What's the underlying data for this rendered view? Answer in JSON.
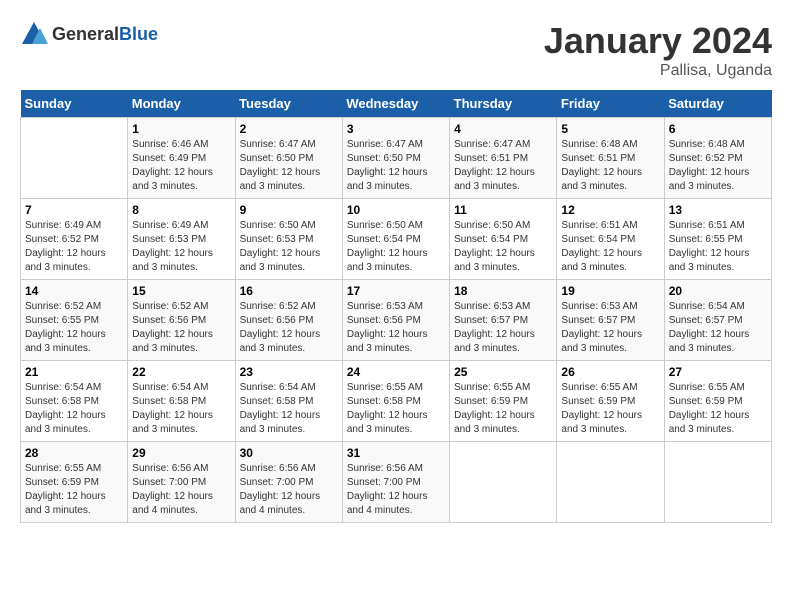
{
  "logo": {
    "general": "General",
    "blue": "Blue"
  },
  "title": "January 2024",
  "subtitle": "Pallisa, Uganda",
  "days_of_week": [
    "Sunday",
    "Monday",
    "Tuesday",
    "Wednesday",
    "Thursday",
    "Friday",
    "Saturday"
  ],
  "weeks": [
    [
      {
        "day": "",
        "sunrise": "",
        "sunset": "",
        "daylight": ""
      },
      {
        "day": "1",
        "sunrise": "Sunrise: 6:46 AM",
        "sunset": "Sunset: 6:49 PM",
        "daylight": "Daylight: 12 hours and 3 minutes."
      },
      {
        "day": "2",
        "sunrise": "Sunrise: 6:47 AM",
        "sunset": "Sunset: 6:50 PM",
        "daylight": "Daylight: 12 hours and 3 minutes."
      },
      {
        "day": "3",
        "sunrise": "Sunrise: 6:47 AM",
        "sunset": "Sunset: 6:50 PM",
        "daylight": "Daylight: 12 hours and 3 minutes."
      },
      {
        "day": "4",
        "sunrise": "Sunrise: 6:47 AM",
        "sunset": "Sunset: 6:51 PM",
        "daylight": "Daylight: 12 hours and 3 minutes."
      },
      {
        "day": "5",
        "sunrise": "Sunrise: 6:48 AM",
        "sunset": "Sunset: 6:51 PM",
        "daylight": "Daylight: 12 hours and 3 minutes."
      },
      {
        "day": "6",
        "sunrise": "Sunrise: 6:48 AM",
        "sunset": "Sunset: 6:52 PM",
        "daylight": "Daylight: 12 hours and 3 minutes."
      }
    ],
    [
      {
        "day": "7",
        "sunrise": "Sunrise: 6:49 AM",
        "sunset": "Sunset: 6:52 PM",
        "daylight": "Daylight: 12 hours and 3 minutes."
      },
      {
        "day": "8",
        "sunrise": "Sunrise: 6:49 AM",
        "sunset": "Sunset: 6:53 PM",
        "daylight": "Daylight: 12 hours and 3 minutes."
      },
      {
        "day": "9",
        "sunrise": "Sunrise: 6:50 AM",
        "sunset": "Sunset: 6:53 PM",
        "daylight": "Daylight: 12 hours and 3 minutes."
      },
      {
        "day": "10",
        "sunrise": "Sunrise: 6:50 AM",
        "sunset": "Sunset: 6:54 PM",
        "daylight": "Daylight: 12 hours and 3 minutes."
      },
      {
        "day": "11",
        "sunrise": "Sunrise: 6:50 AM",
        "sunset": "Sunset: 6:54 PM",
        "daylight": "Daylight: 12 hours and 3 minutes."
      },
      {
        "day": "12",
        "sunrise": "Sunrise: 6:51 AM",
        "sunset": "Sunset: 6:54 PM",
        "daylight": "Daylight: 12 hours and 3 minutes."
      },
      {
        "day": "13",
        "sunrise": "Sunrise: 6:51 AM",
        "sunset": "Sunset: 6:55 PM",
        "daylight": "Daylight: 12 hours and 3 minutes."
      }
    ],
    [
      {
        "day": "14",
        "sunrise": "Sunrise: 6:52 AM",
        "sunset": "Sunset: 6:55 PM",
        "daylight": "Daylight: 12 hours and 3 minutes."
      },
      {
        "day": "15",
        "sunrise": "Sunrise: 6:52 AM",
        "sunset": "Sunset: 6:56 PM",
        "daylight": "Daylight: 12 hours and 3 minutes."
      },
      {
        "day": "16",
        "sunrise": "Sunrise: 6:52 AM",
        "sunset": "Sunset: 6:56 PM",
        "daylight": "Daylight: 12 hours and 3 minutes."
      },
      {
        "day": "17",
        "sunrise": "Sunrise: 6:53 AM",
        "sunset": "Sunset: 6:56 PM",
        "daylight": "Daylight: 12 hours and 3 minutes."
      },
      {
        "day": "18",
        "sunrise": "Sunrise: 6:53 AM",
        "sunset": "Sunset: 6:57 PM",
        "daylight": "Daylight: 12 hours and 3 minutes."
      },
      {
        "day": "19",
        "sunrise": "Sunrise: 6:53 AM",
        "sunset": "Sunset: 6:57 PM",
        "daylight": "Daylight: 12 hours and 3 minutes."
      },
      {
        "day": "20",
        "sunrise": "Sunrise: 6:54 AM",
        "sunset": "Sunset: 6:57 PM",
        "daylight": "Daylight: 12 hours and 3 minutes."
      }
    ],
    [
      {
        "day": "21",
        "sunrise": "Sunrise: 6:54 AM",
        "sunset": "Sunset: 6:58 PM",
        "daylight": "Daylight: 12 hours and 3 minutes."
      },
      {
        "day": "22",
        "sunrise": "Sunrise: 6:54 AM",
        "sunset": "Sunset: 6:58 PM",
        "daylight": "Daylight: 12 hours and 3 minutes."
      },
      {
        "day": "23",
        "sunrise": "Sunrise: 6:54 AM",
        "sunset": "Sunset: 6:58 PM",
        "daylight": "Daylight: 12 hours and 3 minutes."
      },
      {
        "day": "24",
        "sunrise": "Sunrise: 6:55 AM",
        "sunset": "Sunset: 6:58 PM",
        "daylight": "Daylight: 12 hours and 3 minutes."
      },
      {
        "day": "25",
        "sunrise": "Sunrise: 6:55 AM",
        "sunset": "Sunset: 6:59 PM",
        "daylight": "Daylight: 12 hours and 3 minutes."
      },
      {
        "day": "26",
        "sunrise": "Sunrise: 6:55 AM",
        "sunset": "Sunset: 6:59 PM",
        "daylight": "Daylight: 12 hours and 3 minutes."
      },
      {
        "day": "27",
        "sunrise": "Sunrise: 6:55 AM",
        "sunset": "Sunset: 6:59 PM",
        "daylight": "Daylight: 12 hours and 3 minutes."
      }
    ],
    [
      {
        "day": "28",
        "sunrise": "Sunrise: 6:55 AM",
        "sunset": "Sunset: 6:59 PM",
        "daylight": "Daylight: 12 hours and 3 minutes."
      },
      {
        "day": "29",
        "sunrise": "Sunrise: 6:56 AM",
        "sunset": "Sunset: 7:00 PM",
        "daylight": "Daylight: 12 hours and 4 minutes."
      },
      {
        "day": "30",
        "sunrise": "Sunrise: 6:56 AM",
        "sunset": "Sunset: 7:00 PM",
        "daylight": "Daylight: 12 hours and 4 minutes."
      },
      {
        "day": "31",
        "sunrise": "Sunrise: 6:56 AM",
        "sunset": "Sunset: 7:00 PM",
        "daylight": "Daylight: 12 hours and 4 minutes."
      },
      {
        "day": "",
        "sunrise": "",
        "sunset": "",
        "daylight": ""
      },
      {
        "day": "",
        "sunrise": "",
        "sunset": "",
        "daylight": ""
      },
      {
        "day": "",
        "sunrise": "",
        "sunset": "",
        "daylight": ""
      }
    ]
  ]
}
